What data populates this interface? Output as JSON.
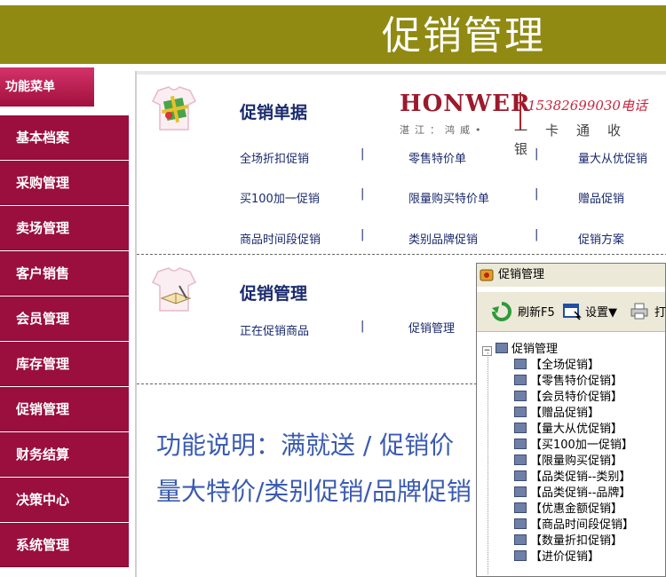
{
  "header": {
    "title": "促销管理"
  },
  "sidebar": {
    "menu_title": "功能菜单",
    "items": [
      "基本档案",
      "采购管理",
      "卖场管理",
      "客户销售",
      "会员管理",
      "库存管理",
      "促销管理",
      "财务结算",
      "决策中心",
      "系统管理"
    ]
  },
  "section1": {
    "title": "促销单据",
    "links": [
      [
        "全场折扣促销",
        "零售特价单",
        "量大从优促销"
      ],
      [
        "买100加一促销",
        "限量购买特价单",
        "赠品促销"
      ],
      [
        "商品时间段促销",
        "类别品牌促销",
        "促销方案"
      ]
    ],
    "separator": "|"
  },
  "brand": {
    "logo": "HONWER",
    "phone": "15382699030电话",
    "slogan_left": "湛江：鸿威•",
    "slogan_right": "一卡通收银"
  },
  "section2": {
    "title": "促销管理",
    "links": [
      "正在促销商品",
      "促销管理"
    ]
  },
  "description": {
    "line1": "功能说明：满就送 / 促销价",
    "line2": "量大特价/类别促销/品牌促销"
  },
  "window": {
    "title": "促销管理",
    "toolbar": {
      "refresh": "刷新F5",
      "settings": "设置▼",
      "print": "打"
    },
    "tree_root": "促销管理",
    "tree_items": [
      "【全场促销】",
      "【零售特价促销】",
      "【会员特价促销】",
      "【赠品促销】",
      "【量大从优促销】",
      "【买100加一促销】",
      "【限量购买促销】",
      "【品类促销--类别】",
      "【品类促销--品牌】",
      "【优惠金额促销】",
      "【商品时间段促销】",
      "【数量折扣促销】",
      "【进价促销】"
    ]
  },
  "colors": {
    "header_bg": "#908a12",
    "sidebar_bg": "#9a0f3e",
    "link": "#1a2a6c",
    "accent": "#3b5bb0"
  }
}
